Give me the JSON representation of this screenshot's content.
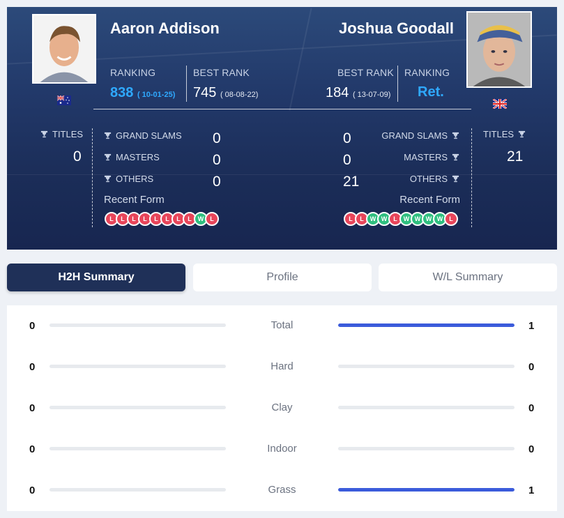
{
  "player1": {
    "name": "Aaron Addison",
    "ranking_label": "RANKING",
    "ranking": "838",
    "ranking_date": "( 10-01-25)",
    "best_rank_label": "BEST RANK",
    "best_rank": "745",
    "best_rank_date": "( 08-08-22)",
    "titles_label": "TITLES",
    "titles": "0",
    "grand_slams_label": "GRAND SLAMS",
    "grand_slams": "0",
    "masters_label": "MASTERS",
    "masters": "0",
    "others_label": "OTHERS",
    "others": "0",
    "recent_form_label": "Recent Form",
    "recent_form": [
      "L",
      "L",
      "L",
      "L",
      "L",
      "L",
      "L",
      "L",
      "W",
      "L"
    ],
    "flag": "australia-flag-icon"
  },
  "player2": {
    "name": "Joshua Goodall",
    "ranking_label": "RANKING",
    "ranking": "Ret.",
    "best_rank_label": "BEST RANK",
    "best_rank": "184",
    "best_rank_date": "( 13-07-09)",
    "titles_label": "TITLES",
    "titles": "21",
    "grand_slams_label": "GRAND SLAMS",
    "grand_slams": "0",
    "masters_label": "MASTERS",
    "masters": "0",
    "others_label": "OTHERS",
    "others": "21",
    "recent_form_label": "Recent Form",
    "recent_form": [
      "L",
      "L",
      "W",
      "W",
      "L",
      "W",
      "W",
      "W",
      "W",
      "L"
    ],
    "flag": "united-kingdom-flag-icon"
  },
  "tabs": [
    {
      "label": "H2H Summary",
      "active": true
    },
    {
      "label": "Profile",
      "active": false
    },
    {
      "label": "W/L Summary",
      "active": false
    }
  ],
  "summary": [
    {
      "category": "Total",
      "p1": "0",
      "p2": "1",
      "p1_share": 0,
      "p2_share": 1
    },
    {
      "category": "Hard",
      "p1": "0",
      "p2": "0",
      "p1_share": 0,
      "p2_share": 0
    },
    {
      "category": "Clay",
      "p1": "0",
      "p2": "0",
      "p1_share": 0,
      "p2_share": 0
    },
    {
      "category": "Indoor",
      "p1": "0",
      "p2": "0",
      "p1_share": 0,
      "p2_share": 0
    },
    {
      "category": "Grass",
      "p1": "0",
      "p2": "1",
      "p1_share": 0,
      "p2_share": 1
    }
  ],
  "colors": {
    "accent_blue": "#2fa9ff",
    "bar_fill": "#3b5bdb",
    "win": "#2fbf7f",
    "loss": "#e8455a",
    "active_tab": "#1f3058"
  }
}
